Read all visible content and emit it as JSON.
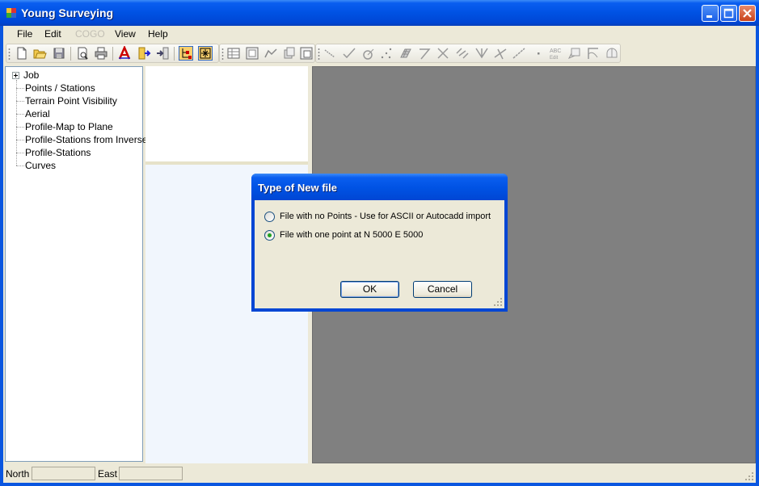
{
  "window": {
    "title": "Young Surveying"
  },
  "menu": {
    "items": [
      {
        "label": "File",
        "enabled": true
      },
      {
        "label": "Edit",
        "enabled": true
      },
      {
        "label": "COGO",
        "enabled": false
      },
      {
        "label": "View",
        "enabled": true
      },
      {
        "label": "Help",
        "enabled": true
      }
    ]
  },
  "tree": {
    "items": [
      {
        "label": "Job",
        "expandable": true
      },
      {
        "label": "Points / Stations"
      },
      {
        "label": "Terrain Point Visibility"
      },
      {
        "label": "Aerial"
      },
      {
        "label": "Profile-Map to Plane"
      },
      {
        "label": "Profile-Stations from Inverse"
      },
      {
        "label": "Profile-Stations"
      },
      {
        "label": "Curves"
      }
    ]
  },
  "toolbar": {
    "edit_label": "ABC Edit"
  },
  "status": {
    "north_label": "North",
    "north_value": "",
    "east_label": "East",
    "east_value": ""
  },
  "dialog": {
    "title": "Type of New file",
    "options": [
      {
        "label": "File with no Points - Use for ASCII or Autocadd import",
        "checked": false
      },
      {
        "label": "File with one point at N 5000 E 5000",
        "checked": true
      }
    ],
    "ok_label": "OK",
    "cancel_label": "Cancel"
  },
  "colors": {
    "title_blue": "#0052e3",
    "canvas_gray": "#808080",
    "dialog_face": "#ece9d8",
    "radio_check": "#21a121"
  }
}
